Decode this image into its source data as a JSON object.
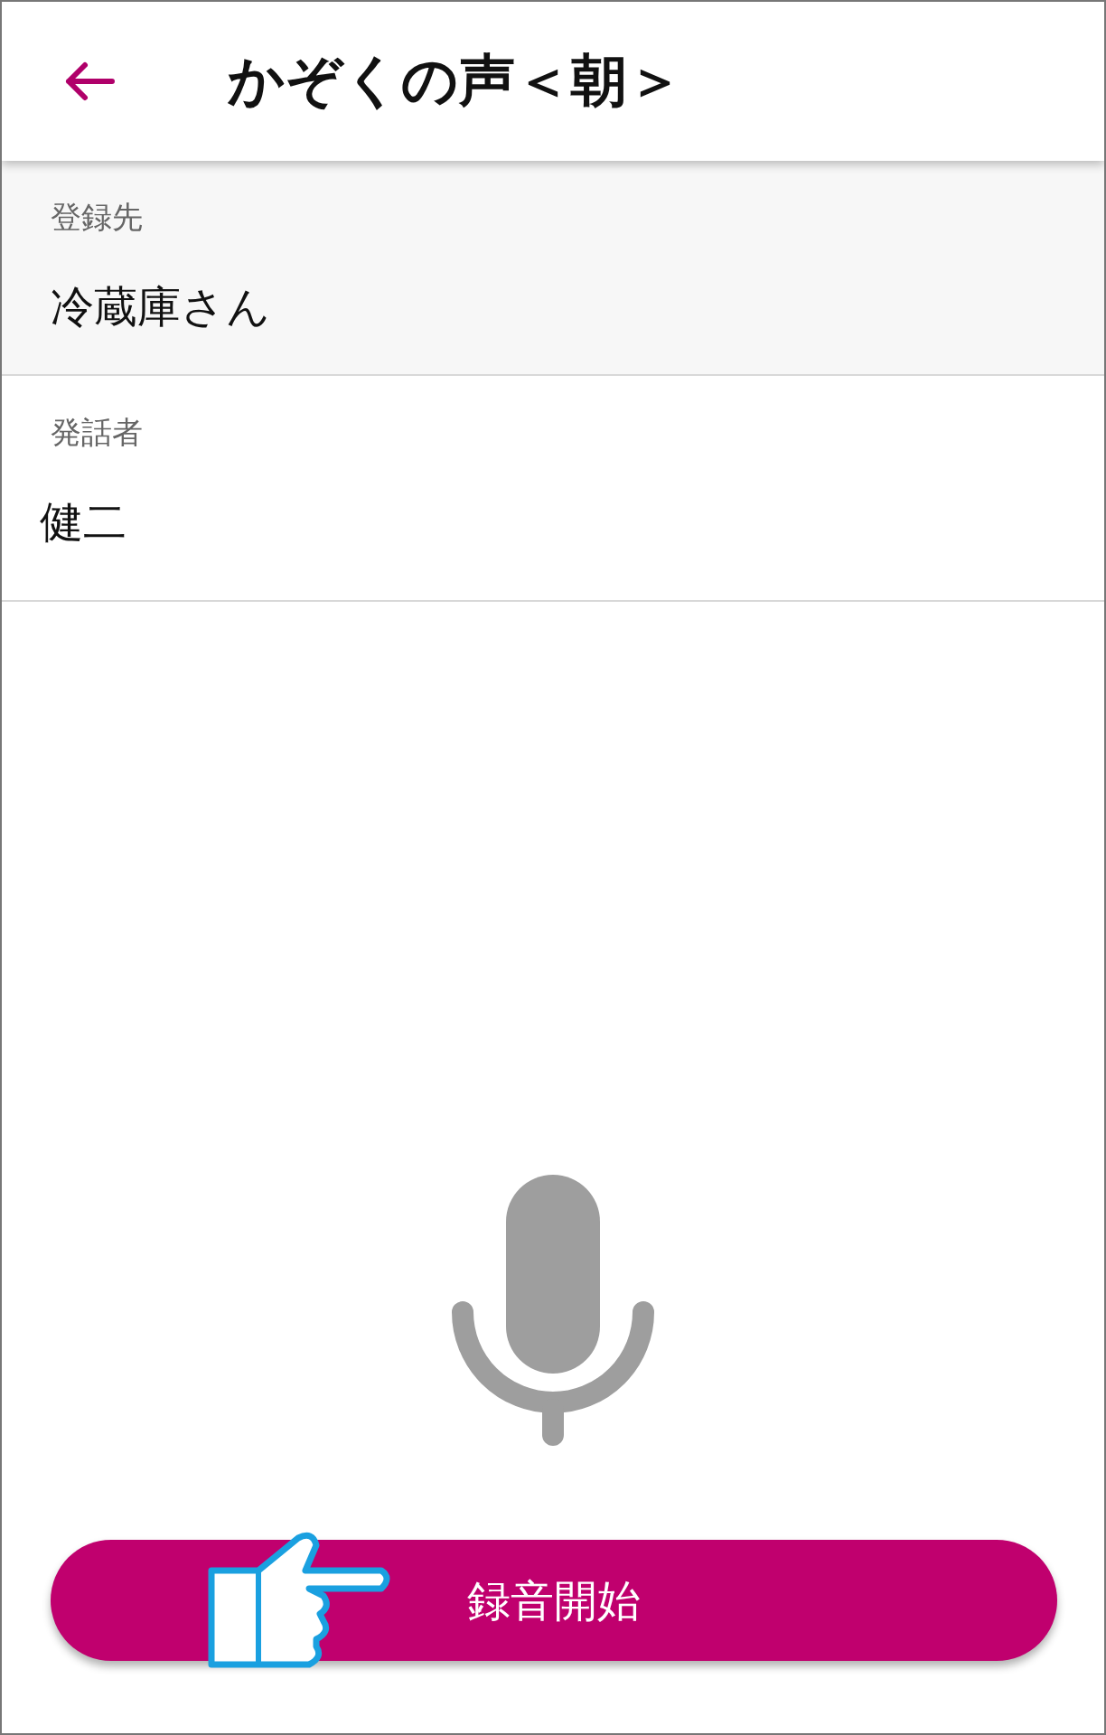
{
  "header": {
    "title": "かぞくの声＜朝＞"
  },
  "fields": [
    {
      "label": "登録先",
      "value": "冷蔵庫さん",
      "shaded": true
    },
    {
      "label": "発話者",
      "value": "健二",
      "shaded": false
    }
  ],
  "record_button": {
    "label": "録音開始"
  }
}
